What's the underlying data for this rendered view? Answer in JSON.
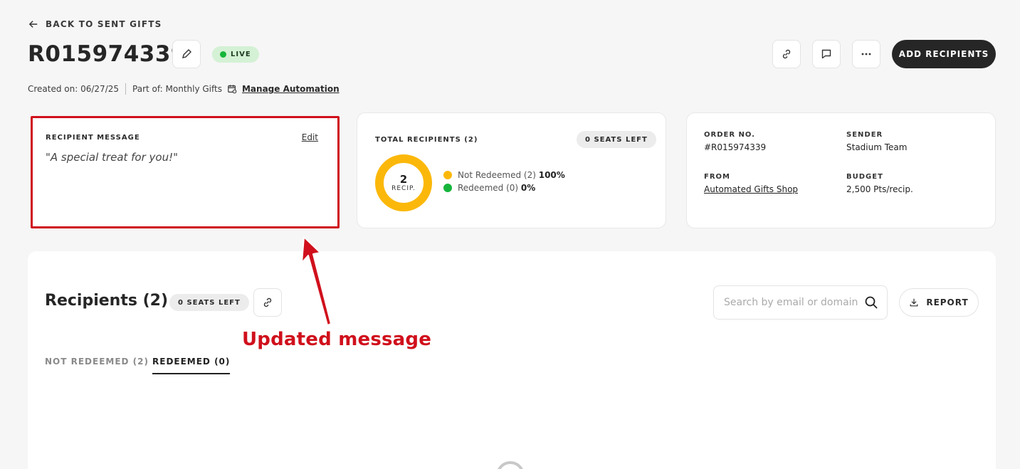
{
  "header": {
    "back_label": "BACK TO SENT GIFTS",
    "order_title": "R015974339",
    "status_badge": "LIVE",
    "add_recipients_label": "ADD RECIPIENTS",
    "created_on": "Created on: 06/27/25",
    "part_of": "Part of: Monthly Gifts",
    "manage_automation": "Manage Automation"
  },
  "message_card": {
    "label": "RECIPIENT MESSAGE",
    "edit_label": "Edit",
    "message": "\"A special treat for you!\""
  },
  "recipients_card": {
    "label": "TOTAL RECIPIENTS (2)",
    "seats_left": "0 SEATS LEFT",
    "donut_count": "2",
    "donut_sub": "RECIP.",
    "not_redeemed_label": "Not Redeemed (2)",
    "not_redeemed_pct": "100%",
    "redeemed_label": "Redeemed (0)",
    "redeemed_pct": "0%",
    "colors": {
      "not_redeemed": "#fbb80a",
      "redeemed": "#16b53a"
    }
  },
  "info_card": {
    "order_no_label": "ORDER NO.",
    "order_no": "#R015974339",
    "sender_label": "SENDER",
    "sender": "Stadium Team",
    "from_label": "FROM",
    "from": "Automated Gifts Shop",
    "budget_label": "BUDGET",
    "budget": "2,500 Pts/recip."
  },
  "recipients_section": {
    "title": "Recipients (2)",
    "seats_left": "0 SEATS LEFT",
    "search_placeholder": "Search by email or domain",
    "report_label": "REPORT",
    "tabs": [
      {
        "label": "NOT REDEEMED (2)"
      },
      {
        "label": "REDEEMED (0)"
      }
    ]
  },
  "annotation": {
    "text": "Updated message",
    "color": "#d0101c"
  }
}
